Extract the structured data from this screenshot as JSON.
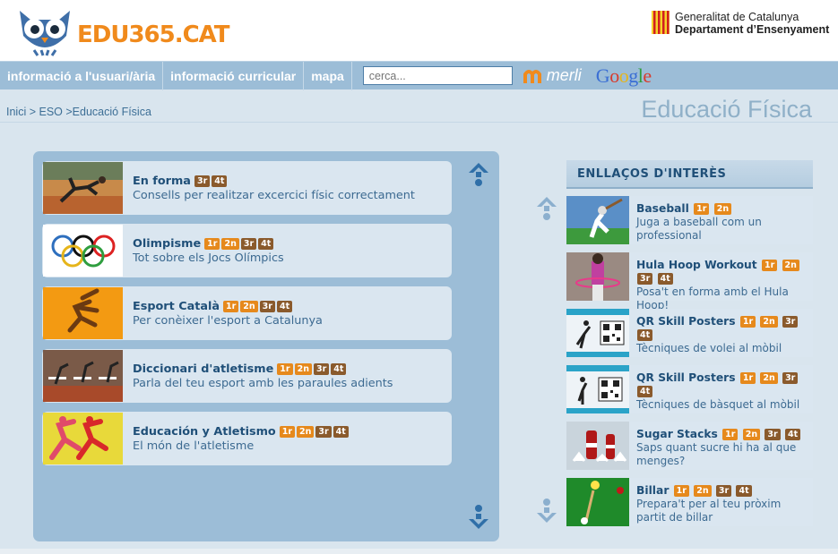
{
  "header": {
    "logo_text": "EDU365.CAT",
    "gen_line1": "Generalitat de Catalunya",
    "gen_line2": "Departament d’Ensenyament"
  },
  "nav": {
    "items": [
      "informació a l'usuari/ària",
      "informació curricular",
      "mapa"
    ],
    "search_placeholder": "cerca...",
    "merli_label": "merli",
    "google_label": "Google"
  },
  "breadcrumb": [
    "Inici",
    " > ",
    "ESO",
    " >",
    "Educació Física"
  ],
  "page_title": "Educació Física",
  "main": {
    "cards": [
      {
        "title": "En forma",
        "badges": [
          "3r",
          "4t"
        ],
        "desc": "Consells per realitzar excercici físic correctament"
      },
      {
        "title": "Olimpisme",
        "badges": [
          "1r",
          "2n",
          "3r",
          "4t"
        ],
        "desc": "Tot sobre els Jocs Olímpics"
      },
      {
        "title": "Esport Català",
        "badges": [
          "1r",
          "2n",
          "3r",
          "4t"
        ],
        "desc": "Per conèixer l'esport a Catalunya"
      },
      {
        "title": "Diccionari d'atletisme",
        "badges": [
          "1r",
          "2n",
          "3r",
          "4t"
        ],
        "desc": "Parla del teu esport amb les paraules adients"
      },
      {
        "title": "Educación y Atletismo",
        "badges": [
          "1r",
          "2n",
          "3r",
          "4t"
        ],
        "desc": "El món de l'atletisme"
      }
    ]
  },
  "sidebar": {
    "heading": "ENLLAÇOS D'INTERÈS",
    "links": [
      {
        "title": "Baseball",
        "badges": [
          "1r",
          "2n"
        ],
        "desc": "Juga a baseball com un professional"
      },
      {
        "title": "Hula Hoop Workout",
        "badges": [
          "1r",
          "2n",
          "3r",
          "4t"
        ],
        "desc": "Posa't en forma amb el Hula Hoop!"
      },
      {
        "title": "QR Skill Posters",
        "badges": [
          "1r",
          "2n",
          "3r",
          "4t"
        ],
        "desc": "Tècniques de volei al mòbil"
      },
      {
        "title": "QR Skill Posters",
        "badges": [
          "1r",
          "2n",
          "3r",
          "4t"
        ],
        "desc": "Tècniques de bàsquet al mòbil"
      },
      {
        "title": "Sugar Stacks",
        "badges": [
          "1r",
          "2n",
          "3r",
          "4t"
        ],
        "desc": "Saps quant sucre hi ha al que menges?"
      },
      {
        "title": "Billar",
        "badges": [
          "1r",
          "2n",
          "3r",
          "4t"
        ],
        "desc": "Prepara't per al teu pròxim partit de billar"
      }
    ]
  },
  "colors": {
    "nav_bg": "#9cbdd7",
    "badge_orange": "#e6891c",
    "badge_brown": "#8a5a2c",
    "title_blue": "#1f4f78"
  }
}
